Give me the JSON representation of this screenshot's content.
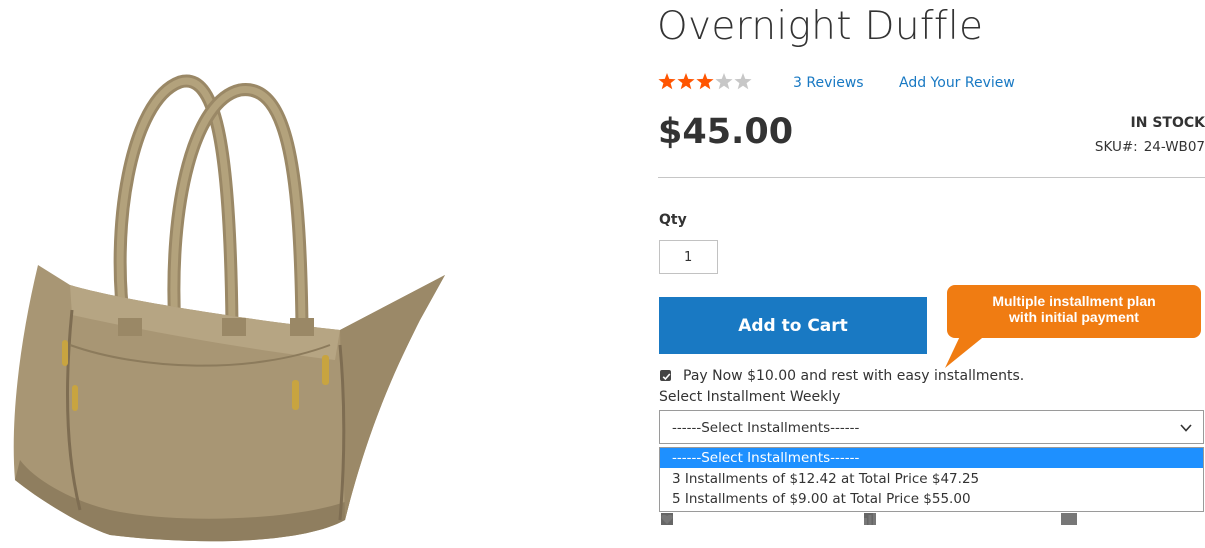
{
  "product": {
    "name": "Overnight Duffle",
    "rating": {
      "stars_filled": 3,
      "stars_total": 5,
      "reviews_label": "3 Reviews",
      "add_review_label": "Add Your Review",
      "filled_color": "#ff5501",
      "empty_color": "#c7c7c7"
    },
    "price": "$45.00",
    "stock_status": "IN STOCK",
    "sku_label": "SKU#:",
    "sku_value": "24-WB07",
    "image_icon": "duffle-bag-image"
  },
  "purchase": {
    "qty_label": "Qty",
    "qty_value": "1",
    "add_to_cart_label": "Add to Cart",
    "accent_color": "#1979c3"
  },
  "callout": {
    "line1": "Multiple installment plan",
    "line2": "with initial payment",
    "color": "#f07c12"
  },
  "installments": {
    "pay_now_checked": true,
    "pay_now_label": "Pay Now $10.00 and rest with easy installments.",
    "select_label": "Select Installment Weekly",
    "selected_value": "------Select Installments------",
    "options": [
      "------Select Installments------",
      "3 Installments of $12.42 at Total Price $47.25",
      "5 Installments of $9.00 at Total Price $55.00"
    ],
    "highlight_color": "#1e90ff"
  },
  "actions": {
    "icons": [
      "heart-icon",
      "bar-chart-icon",
      "envelope-icon"
    ]
  }
}
